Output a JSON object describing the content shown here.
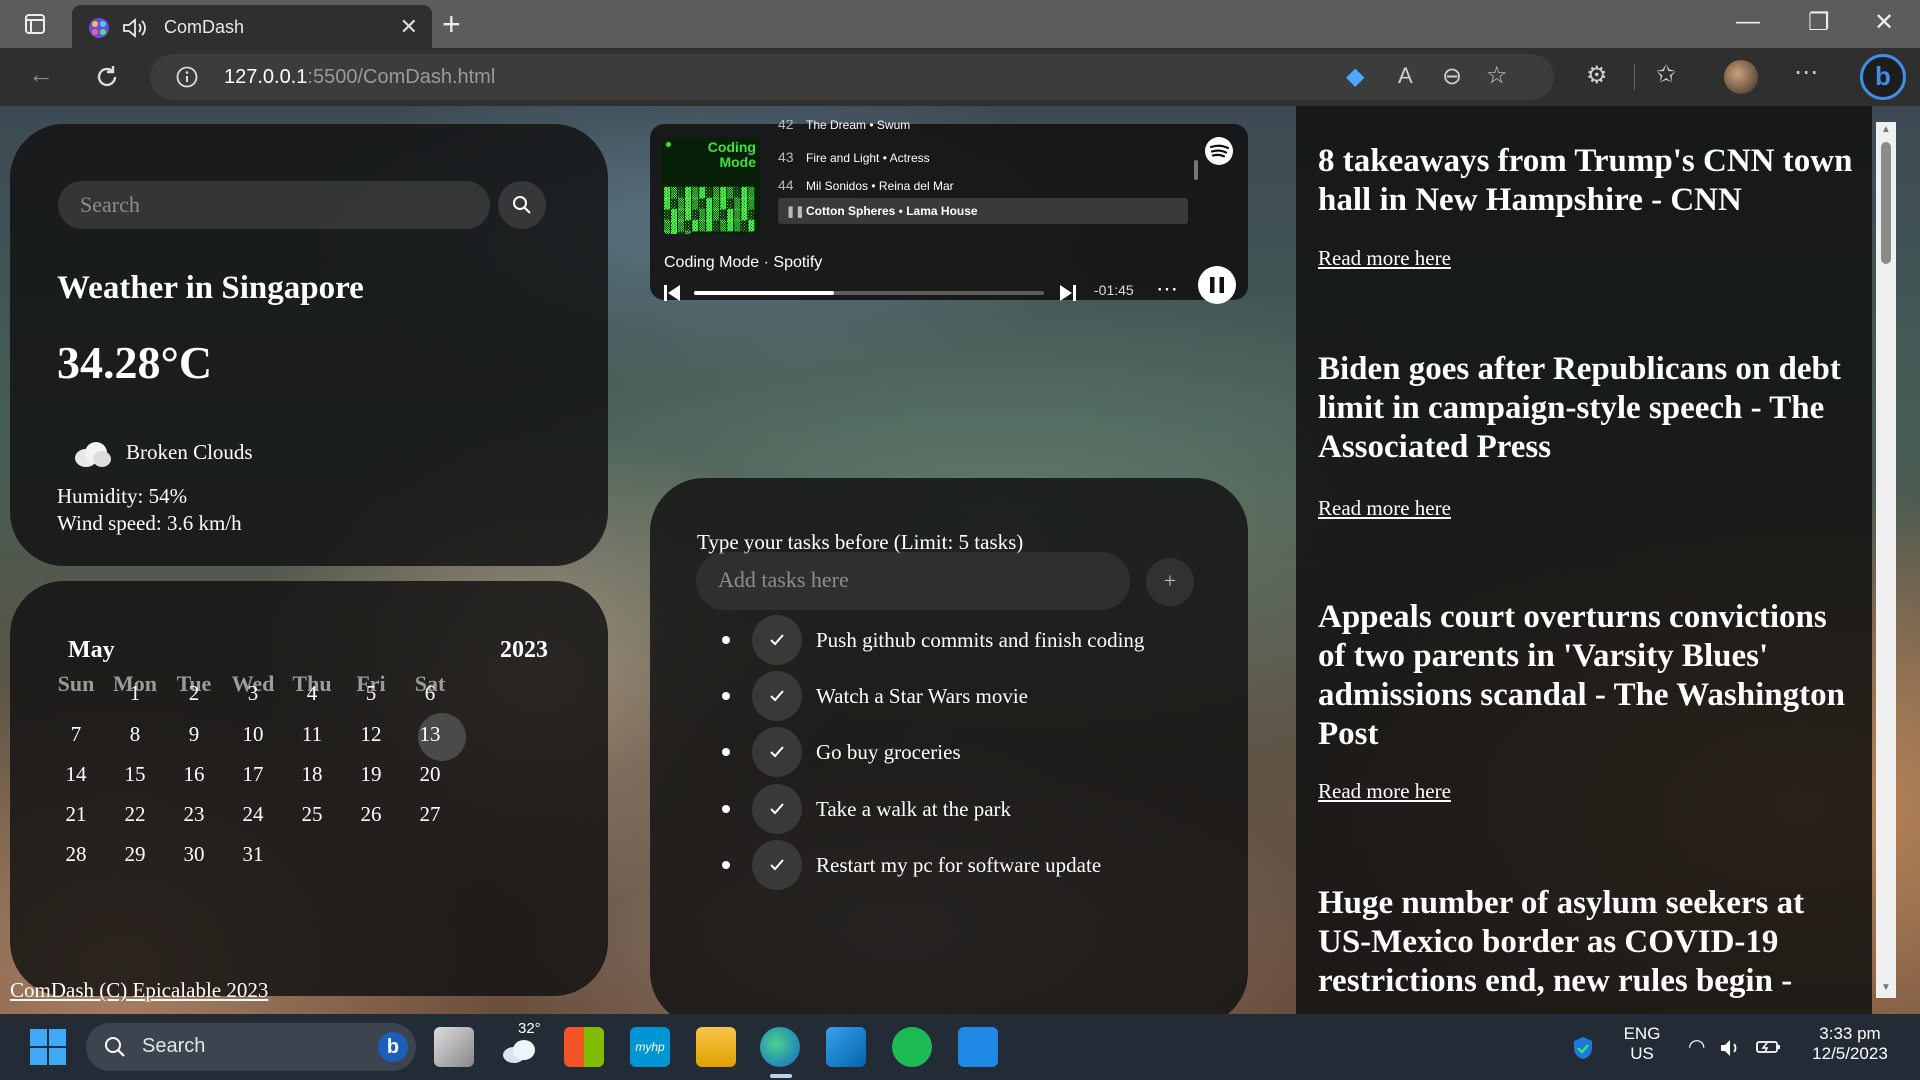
{
  "browser": {
    "tab_title": "ComDash",
    "url_host": "127.0.0.1",
    "url_rest": ":5500/ComDash.html"
  },
  "weather": {
    "search_placeholder": "Search",
    "title": "Weather in Singapore",
    "temperature": "34.28°C",
    "description": "Broken Clouds",
    "humidity": "Humidity: 54%",
    "wind": "Wind speed: 3.6 km/h"
  },
  "calendar": {
    "month": "May",
    "year": "2023",
    "weekdays": [
      "Sun",
      "Mon",
      "Tue",
      "Wed",
      "Thu",
      "Fri",
      "Sat"
    ],
    "weeks": [
      [
        "",
        "1",
        "2",
        "3",
        "4",
        "5",
        "6"
      ],
      [
        "7",
        "8",
        "9",
        "10",
        "11",
        "12",
        "13"
      ],
      [
        "14",
        "15",
        "16",
        "17",
        "18",
        "19",
        "20"
      ],
      [
        "21",
        "22",
        "23",
        "24",
        "25",
        "26",
        "27"
      ],
      [
        "28",
        "29",
        "30",
        "31",
        "",
        "",
        ""
      ]
    ],
    "today": "12"
  },
  "footer": {
    "text": "ComDash (C) Epicalable 2023"
  },
  "spotify": {
    "cover_text": "Coding Mode",
    "tracks": [
      {
        "n": "42",
        "title": "The Dream",
        "artist": "Swum"
      },
      {
        "n": "43",
        "title": "Fire and Light",
        "artist": "Actress"
      },
      {
        "n": "44",
        "title": "Mil Sonidos",
        "artist": "Reina del Mar"
      },
      {
        "n": "",
        "title": "Cotton Spheres",
        "artist": "Lama House"
      }
    ],
    "playlist": "Coding Mode",
    "source": "Spotify",
    "remaining": "-01:45",
    "progress": 0.4,
    "brand_color": "#1DB954"
  },
  "tasks": {
    "title": "Type your tasks before (Limit: 5 tasks)",
    "placeholder": "Add tasks here",
    "add_label": "+",
    "items": [
      "Push github commits and finish coding",
      "Watch a Star Wars movie",
      "Go buy groceries",
      "Take a walk at the park",
      "Restart my pc for software update"
    ]
  },
  "news": {
    "items": [
      {
        "title": "8 takeaways from Trump's CNN town hall in New Hampshire - CNN",
        "link": "Read more here"
      },
      {
        "title": "Biden goes after Republicans on debt limit in campaign-style speech - The Associated Press",
        "link": "Read more here"
      },
      {
        "title": "Appeals court overturns convictions of two parents in 'Varsity Blues' admissions scandal - The Washington Post",
        "link": "Read more here"
      },
      {
        "title": "Huge number of asylum seekers at US-Mexico border as COVID-19 restrictions end, new rules begin -",
        "link": ""
      }
    ]
  },
  "taskbar": {
    "search": "Search",
    "weather_temp": "32°",
    "language": "ENG",
    "region": "US",
    "time": "3:33 pm",
    "date": "12/5/2023"
  }
}
